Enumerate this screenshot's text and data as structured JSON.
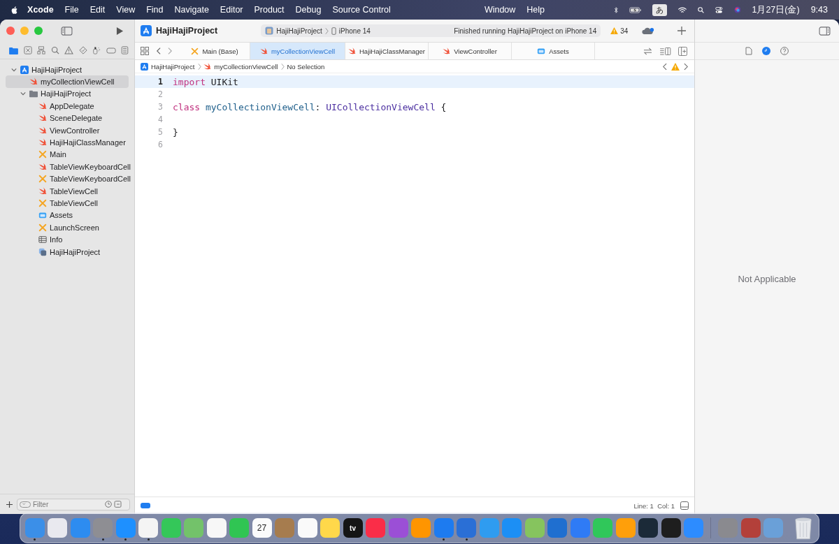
{
  "menu_bar": {
    "app_name": "Xcode",
    "menus": [
      "File",
      "Edit",
      "View",
      "Find",
      "Navigate",
      "Editor",
      "Product",
      "Debug",
      "Source Control",
      "Window",
      "Help"
    ],
    "input_mode": "あ",
    "date": "1月27日(金)",
    "time": "9:43"
  },
  "toolbar": {
    "project": "HajiHajiProject",
    "scheme": "HajiHajiProject",
    "destination": "iPhone 14",
    "status": "Finished running HajiHajiProject on iPhone 14",
    "warning_count": "34"
  },
  "navigator": {
    "items": [
      {
        "label": "HajiHajiProject",
        "kind": "project",
        "selected": false,
        "expanded": true,
        "children": [
          {
            "label": "myCollectionViewCell",
            "kind": "swift",
            "selected": true
          },
          {
            "label": "HajiHajiProject",
            "kind": "folder",
            "selected": false,
            "expanded": true,
            "children": [
              {
                "label": "AppDelegate",
                "kind": "swift",
                "selected": false
              },
              {
                "label": "SceneDelegate",
                "kind": "swift",
                "selected": false
              },
              {
                "label": "ViewController",
                "kind": "swift",
                "selected": false
              },
              {
                "label": "HajiHajiClassManager",
                "kind": "swift",
                "selected": false
              },
              {
                "label": "Main",
                "kind": "storyboard",
                "selected": false
              },
              {
                "label": "TableViewKeyboardCell",
                "kind": "swift",
                "selected": false
              },
              {
                "label": "TableViewKeyboardCell",
                "kind": "storyboard",
                "selected": false
              },
              {
                "label": "TableViewCell",
                "kind": "swift",
                "selected": false
              },
              {
                "label": "TableViewCell",
                "kind": "storyboard",
                "selected": false
              },
              {
                "label": "Assets",
                "kind": "assets",
                "selected": false
              },
              {
                "label": "LaunchScreen",
                "kind": "storyboard",
                "selected": false
              },
              {
                "label": "Info",
                "kind": "plist",
                "selected": false
              },
              {
                "label": "HajiHajiProject",
                "kind": "target",
                "selected": false
              }
            ]
          }
        ]
      }
    ],
    "filter": {
      "placeholder": "Filter"
    }
  },
  "tabs": [
    {
      "label": "Main (Base)",
      "kind": "storyboard",
      "selected": false
    },
    {
      "label": "myCollectionViewCell",
      "kind": "swift",
      "selected": true
    },
    {
      "label": "HajiHajiClassManager",
      "kind": "swift",
      "selected": false
    },
    {
      "label": "ViewController",
      "kind": "swift",
      "selected": false
    },
    {
      "label": "Assets",
      "kind": "assets",
      "selected": false
    }
  ],
  "jump_bar": [
    {
      "label": "HajiHajiProject",
      "kind": "project"
    },
    {
      "label": "myCollectionViewCell",
      "kind": "swift"
    },
    {
      "label": "No Selection",
      "kind": "none"
    }
  ],
  "editor": {
    "lines": [
      {
        "number": "1",
        "current": true,
        "tokens": [
          {
            "text": "import",
            "kind": "keyword"
          },
          {
            "text": " UIKit",
            "kind": "plain"
          }
        ]
      },
      {
        "number": "2",
        "current": false
      },
      {
        "number": "3",
        "current": false,
        "tokens": [
          {
            "text": "class",
            "kind": "keyword"
          },
          {
            "text": " myCollectionViewCell",
            "kind": "decl"
          },
          {
            "text": ": ",
            "kind": "plain"
          },
          {
            "text": "UICollectionViewCell",
            "kind": "type"
          },
          {
            "text": " {",
            "kind": "plain"
          }
        ]
      },
      {
        "number": "4",
        "current": false
      },
      {
        "number": "5",
        "current": false,
        "tokens": [
          {
            "text": "}",
            "kind": "plain"
          }
        ]
      },
      {
        "number": "6",
        "current": false
      }
    ]
  },
  "status_bar": {
    "position": "Line: 1  Col: 1"
  },
  "inspector": {
    "message": "Not Applicable"
  },
  "dock": {
    "apps": [
      {
        "color": "#3b8fe8",
        "running": true
      },
      {
        "color": "#e9e9ef",
        "running": false
      },
      {
        "color": "#2d8cf0",
        "running": false
      },
      {
        "color": "#8e8e93",
        "running": true
      },
      {
        "color": "#1e90ff",
        "running": true
      },
      {
        "color": "#f4f4f4",
        "running": true
      },
      {
        "color": "#34c759",
        "running": false
      },
      {
        "color": "#73c26a",
        "running": false
      },
      {
        "color": "#f7f7f7",
        "running": false
      },
      {
        "color": "#30c553",
        "running": false
      },
      {
        "color": "#fbfbfb",
        "running": false,
        "label": "27"
      },
      {
        "color": "#a67c4e",
        "running": false
      },
      {
        "color": "#fafafa",
        "running": false
      },
      {
        "color": "#ffd84a",
        "running": false
      },
      {
        "color": "#151515",
        "running": false,
        "label": "tv"
      },
      {
        "color": "#fa2d48",
        "running": false
      },
      {
        "color": "#9b4fd6",
        "running": false
      },
      {
        "color": "#ff9500",
        "running": false
      },
      {
        "color": "#1d7bf0",
        "running": true
      },
      {
        "color": "#2a6fd6",
        "running": true
      },
      {
        "color": "#2f9cf0",
        "running": false
      },
      {
        "color": "#1c8ff5",
        "running": false
      },
      {
        "color": "#86c45e",
        "running": false
      },
      {
        "color": "#1f6fd0",
        "running": false
      },
      {
        "color": "#2f7bf5",
        "running": false
      },
      {
        "color": "#30c75a",
        "running": false
      },
      {
        "color": "#ff9f0a",
        "running": false
      },
      {
        "color": "#1b2a38",
        "running": false
      },
      {
        "color": "#1e1e1e",
        "running": false
      },
      {
        "color": "#2d8cff",
        "running": false
      }
    ],
    "others": [
      {
        "color": "#8a8a8f",
        "running": false
      },
      {
        "color": "#b3403a",
        "running": false
      },
      {
        "color": "#6aa0d8",
        "running": false
      }
    ]
  }
}
